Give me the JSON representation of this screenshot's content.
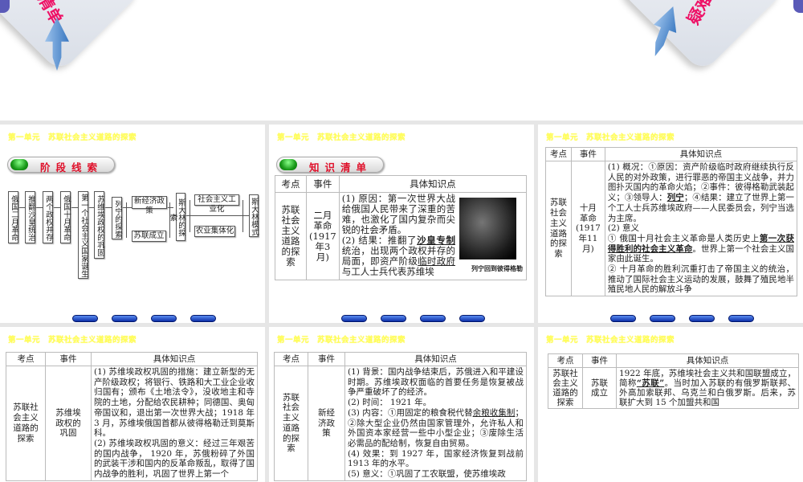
{
  "top_slide": {
    "left_logo_text": "清单",
    "right_logo_text": "疑难"
  },
  "unit_title": "第一单元　苏联社会主义道路的探索",
  "slide1": {
    "banner": "阶段线索",
    "flow": [
      "俄国二月革命",
      "推翻沙皇统治",
      "两个政权并存",
      "俄国十月革命",
      "第一个社会主义国家诞生",
      "苏维埃政权的巩固",
      "列宁的探索",
      "新经济政策",
      "苏联成立",
      "斯大林的探索",
      "社会主义工业化",
      "农业集体化",
      "斯大林模式"
    ]
  },
  "table_headers": [
    "考点",
    "事件",
    "具体知识点"
  ],
  "slide2": {
    "banner": "知识清单",
    "topic": "苏联社会主义道路的探索",
    "event": "二月革命(1917年3月)",
    "content": [
      {
        "t": "(1) 原因：第一次世界大战给俄国人民带来了深重的苦难，也激化了国内复杂而尖锐的社会矛盾。"
      },
      {
        "t": "(2) 结果：推翻了",
        "br": true
      },
      {
        "t": "沙皇专制",
        "s": "b u"
      },
      {
        "t": "统治，出现两个政权并存的局面，即资产阶级"
      },
      {
        "t": "临时政府",
        "s": "u"
      },
      {
        "t": "与工人士兵代表苏维埃"
      }
    ],
    "image_caption": "列宁回到彼得格勒"
  },
  "slide3": {
    "topic": "苏联社会主义道路的探索",
    "event": "十月革命(1917年11月)",
    "content": [
      {
        "t": "(1) 概况：①原因：资产阶级临时政府继续执行反人民的对外政策，进行罪恶的帝国主义战争，并力图扑灭国内的革命火焰；②事件：彼得格勒武装起义；③领导人："
      },
      {
        "t": "列宁",
        "s": "b u"
      },
      {
        "t": "；④结果：建立了世界上第一个工人士兵苏维埃政府——人民委员会，列宁当选为主席。"
      },
      {
        "t": "(2) 意义",
        "br": true
      },
      {
        "t": "① 俄国十月社会主义革命是人类历史上",
        "br": true
      },
      {
        "t": "第一次获得胜利的社会主义革命",
        "s": "b u"
      },
      {
        "t": "。世界上第一个社会主义国家由此诞生。"
      },
      {
        "t": "② 十月革命的胜利沉重打击了帝国主义的统治，推动了国际社会主义运动的发展，鼓舞了殖民地半殖民地人民的解放斗争",
        "br": true
      }
    ]
  },
  "slide4": {
    "topic": "苏联社会主义道路的探索",
    "event": "苏维埃政权的巩固",
    "content": [
      {
        "t": "(1) 苏维埃政权巩固的措施：建立新型的无产阶级政权；将银行、铁路和大工业企业收归国有；颁布《土地法令》，没收地主和寺院的土地，分配给农民耕种；同德国、奥匈帝国议和，退出第一次世界大战；1918 年 3 月，苏维埃俄国首都从彼得格勒迁到莫斯科。"
      },
      {
        "t": "(2) 苏维埃政权巩固的意义：经过三年艰苦的国内战争， 1920 年，苏俄粉碎了外国的武装干涉和国内的反革命叛乱，取得了国内战争的胜利，巩固了世界上第一个",
        "br": true
      }
    ]
  },
  "slide5": {
    "topic": "苏联社会主义道路的探索",
    "event": "新经济政策",
    "content": [
      {
        "t": "(1) 背景：国内战争结束后，苏俄进入和平建设时期。苏维埃政权面临的首要任务是恢复被战争严重破坏了的经济。"
      },
      {
        "t": "(2) 时间： 1921 年。",
        "br": true
      },
      {
        "t": "(3) 内容：①用固定的粮食税代替",
        "br": true
      },
      {
        "t": "余粮收集制",
        "s": "u"
      },
      {
        "t": "；②除大型企业仍然由国家管理外，允许私人和外国资本家经营一些中小型企业；③废除生活必需品的配给制，恢复自由贸易。"
      },
      {
        "t": "(4) 效果：到 1927 年，国家经济恢复到战前 1913 年的水平。",
        "br": true
      },
      {
        "t": "(5) 意义：①巩固了工农联盟，使苏维埃政",
        "br": true
      }
    ]
  },
  "slide6": {
    "topic": "苏联社会主义道路的探索",
    "event": "苏联成立",
    "content": [
      {
        "t": "1922 年底，苏维埃社会主义共和国联盟成立，简称"
      },
      {
        "t": "“苏联”",
        "s": "b u"
      },
      {
        "t": "。当时加入苏联的有俄罗斯联邦、外高加索联邦、乌克兰和白俄罗斯。后来，苏联扩大到 15 个加盟共和国"
      }
    ]
  },
  "colors": {
    "unit_title": "#ffff55",
    "banner_text": "#e0102a",
    "nav_button": "#1c44c8",
    "gap": "#e6e6e6"
  }
}
